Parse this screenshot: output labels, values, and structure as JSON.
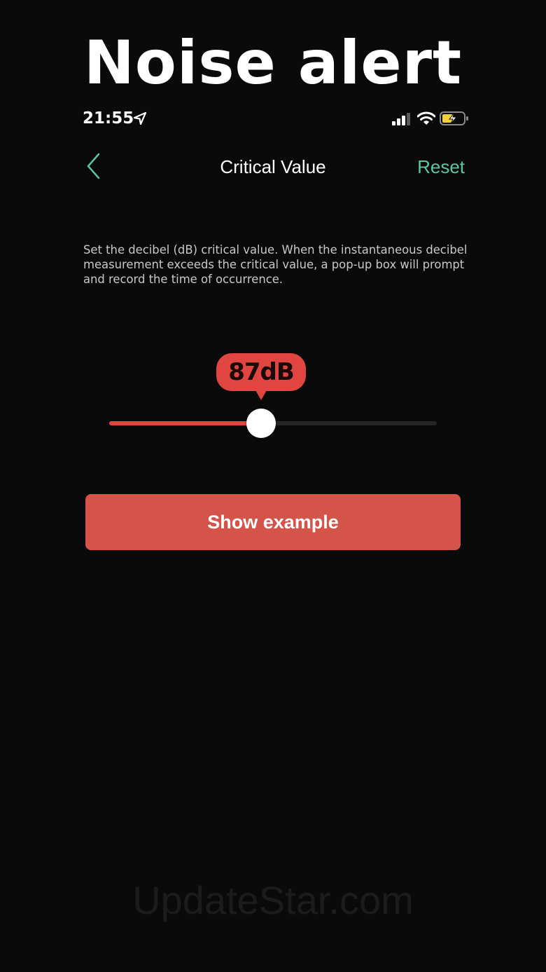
{
  "headline": "Noise alert",
  "status_bar": {
    "time": "21:55",
    "icons": [
      "location-arrow-icon",
      "cellular-signal-icon",
      "wifi-icon",
      "battery-charging-icon"
    ]
  },
  "nav": {
    "back_icon": "chevron-left-icon",
    "title": "Critical Value",
    "reset_label": "Reset",
    "accent_color": "#5cc6a0"
  },
  "description": "Set the decibel (dB) critical value. When the instantaneous decibel measurement exceeds the critical value, a pop-up box will prompt and record the time of occurrence.",
  "slider": {
    "value_label": "87dB",
    "fill_fraction": 0.463,
    "fill_color": "#e0463f",
    "track_color": "#262626"
  },
  "show_example": {
    "label": "Show example",
    "color": "#d4544a"
  },
  "watermark": "UpdateStar.com"
}
